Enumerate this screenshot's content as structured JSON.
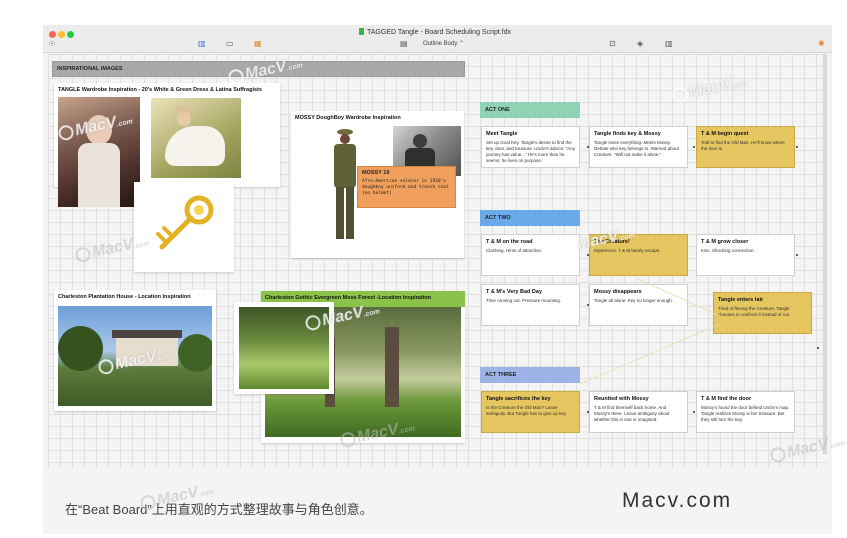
{
  "window": {
    "title": "TAGGED Tangle - Board Scheduling Script.fdx",
    "toolbar": {
      "outline_label": "Outline Body"
    }
  },
  "inspirational": {
    "header": "INSPIRATIONAL IMAGES",
    "panels": {
      "tangle": "TANGLE Wardrobe Inspiration - 20's White & Green Dress & Latina Suffragists",
      "mossy": "MOSSY DoughBoy Wardrobe Inspiration",
      "plantation": "Charleston Plantation House - Location Inspiration",
      "forest": "Charleston Gothic Evergreen Moss Forest -Location Inspiration"
    },
    "note": {
      "title": "MOSSY 19",
      "body": "Afro-American soldier in 1920's doughboy uniform and trench coat (no helmet)"
    }
  },
  "acts": {
    "one": {
      "label": "ACT ONE",
      "color": "#8fd3b4",
      "cards": [
        {
          "title": "Meet Tangle",
          "body": "Set up Goal Key. Tangle's desire to find the key, door, and treasure. Uncle's advice: \"Any journey has value...\" He's more than he seems; he lives on purpose.",
          "color": "white"
        },
        {
          "title": "Tangle finds key & Mossy",
          "body": "Tangle loses everything. Meets Mossy. Debate who key belongs to. Warned about Creature. \"Will not make it alone.\"",
          "color": "white"
        },
        {
          "title": "T & M begin quest",
          "body": "Told to find the Old Man. He'll know where the door is.",
          "color": "yellow"
        }
      ]
    },
    "two": {
      "label": "ACT TWO",
      "color": "#6aa9ea",
      "cards": [
        {
          "title": "T & M on the road",
          "body": "Clashing. Hints of attraction.",
          "color": "white"
        },
        {
          "title": "The Creature!",
          "body": "Mysterious. T & M barely escape.",
          "color": "yellow"
        },
        {
          "title": "T & M grow closer",
          "body": "Kiss. Shocking connection.",
          "color": "white"
        },
        {
          "title": "T & M's Very Bad Day",
          "body": "Time running out. Pressure mounting.",
          "color": "white"
        },
        {
          "title": "Mossy disappears",
          "body": "Tangle all alone. Key no longer enough.",
          "color": "white"
        },
        {
          "title": "Tangle enters lair",
          "body": "Tired of fleeing the Creature, Tangle chooses to confront it instead of run.",
          "color": "yellow"
        }
      ]
    },
    "three": {
      "label": "ACT THREE",
      "color": "#9fb4e6",
      "cards": [
        {
          "title": "Tangle sacrifices the key",
          "body": "Is the Creature the Old Man? Leave ambiguity. But Tangle has to give up key.",
          "color": "yellow"
        },
        {
          "title": "Reunited with Mossy",
          "body": "T & M find themself back home. And Mossy's there. Leave ambiguity about whether this is real or imagined.",
          "color": "white"
        },
        {
          "title": "T & M find the door",
          "body": "Mossy's found the door behind Uncle's map. Tangle realizes Mossy is her treasure. But they still turn the key.",
          "color": "white"
        }
      ]
    }
  },
  "caption": {
    "text": "在“Beat Board”上用直观的方式整理故事与角色创意。",
    "brand": "Macv.com"
  },
  "watermark": {
    "brand": "MacV",
    "suffix": ".com"
  }
}
